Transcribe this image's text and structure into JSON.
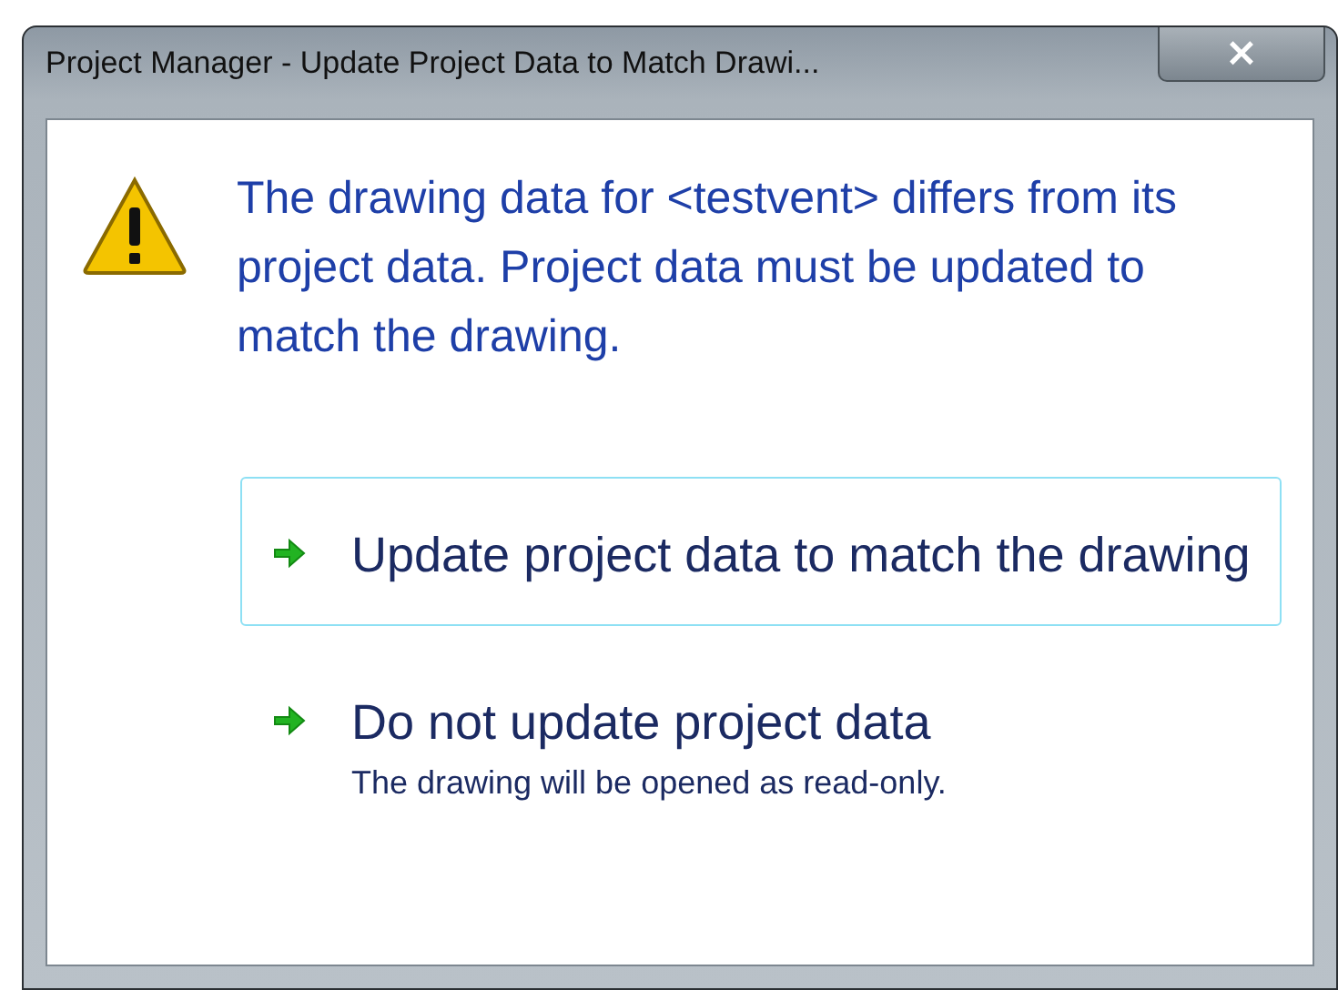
{
  "window": {
    "title": "Project Manager - Update Project Data to Match Drawi...",
    "close": "×"
  },
  "message": "The drawing data for <testvent> differs from its project data. Project data must be updated to match the drawing.",
  "options": [
    {
      "label": "Update project data to match the drawing",
      "selected": true
    },
    {
      "label": "Do not update project data",
      "note": "The drawing will be opened as read-only.",
      "selected": false
    }
  ]
}
